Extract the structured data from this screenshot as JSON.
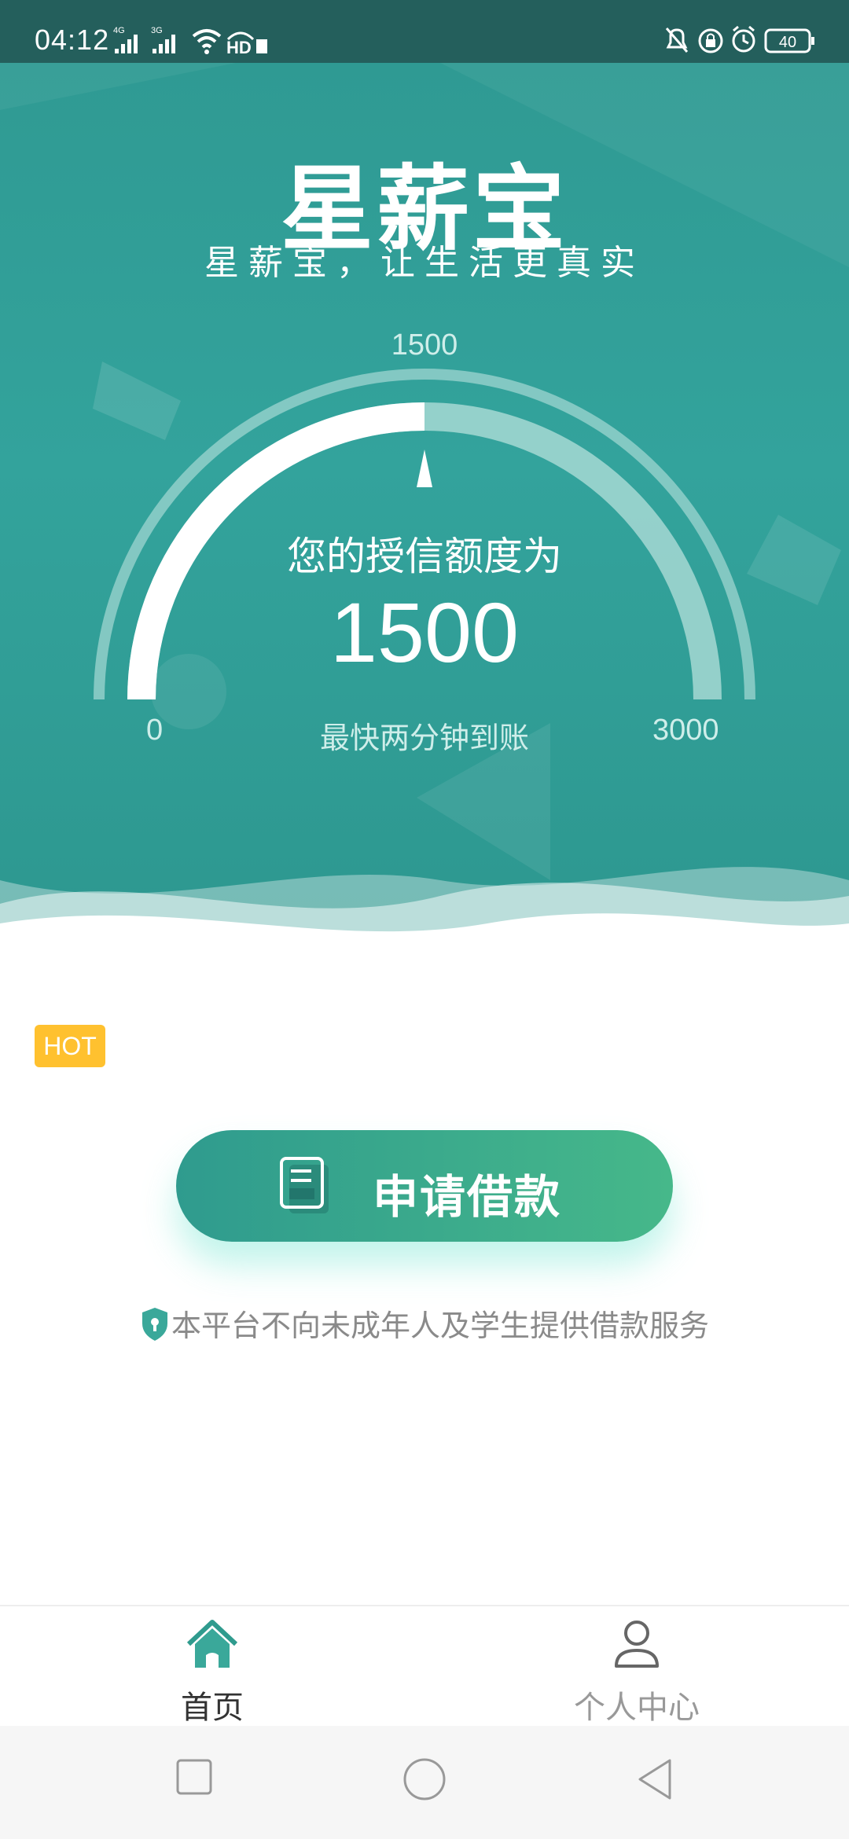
{
  "status_bar": {
    "time": "04:12",
    "network_1": "4G",
    "network_2": "3G",
    "hd_label": "HD",
    "battery": "40"
  },
  "hero": {
    "app_name": "星薪宝",
    "slogan": "星薪宝，让生活更真实",
    "gauge": {
      "top_label": "1500",
      "min_label": "0",
      "max_label": "3000",
      "caption": "您的授信额度为",
      "amount": "1500",
      "subcaption": "最快两分钟到账",
      "min": 0,
      "max": 3000,
      "value": 1500
    }
  },
  "hot_badge": "HOT",
  "apply_button": {
    "label": "申请借款"
  },
  "disclaimer": "本平台不向未成年人及学生提供借款服务",
  "tabs": [
    {
      "label": "首页",
      "icon": "home-icon",
      "active": true
    },
    {
      "label": "个人中心",
      "icon": "person-icon",
      "active": false
    }
  ],
  "colors": {
    "primary": "#33a39c",
    "button_start": "#2f9b8e",
    "button_end": "#46b88a",
    "hot": "#ffc12f"
  }
}
